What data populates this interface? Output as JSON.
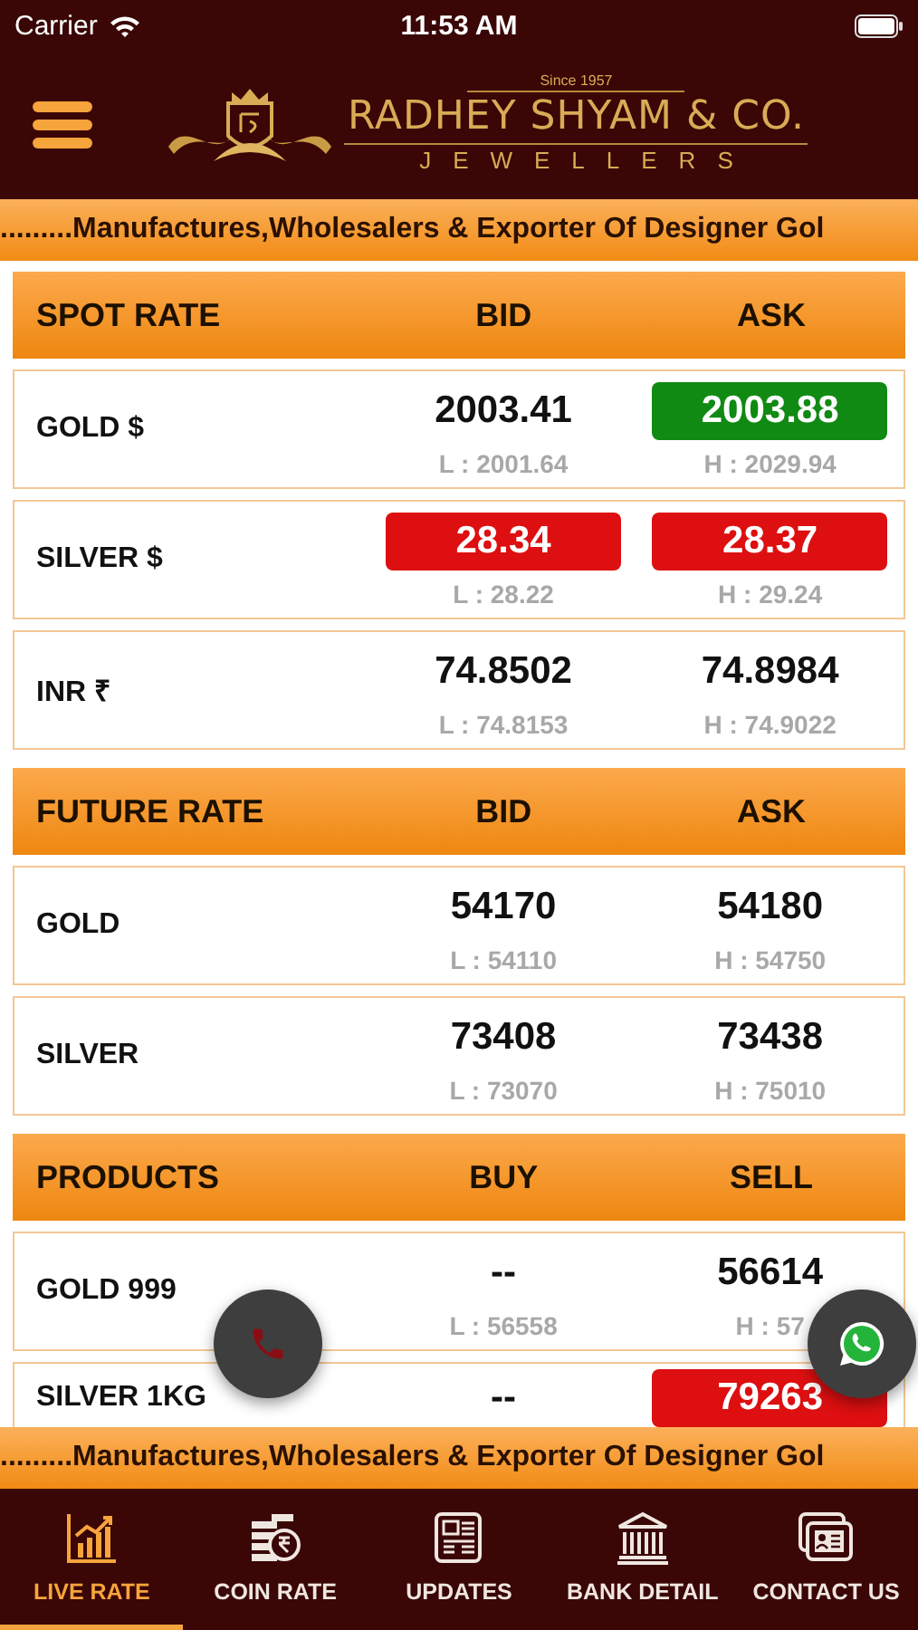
{
  "status_bar": {
    "carrier": "Carrier",
    "time": "11:53 AM"
  },
  "header": {
    "since": "Since 1957",
    "brand": "RADHEY SHYAM & CO.",
    "subtitle": "JEWELLERS"
  },
  "ticker_top": ".........Manufactures,Wholesalers & Exporter Of Designer Gol",
  "sections": [
    {
      "columns": [
        "SPOT RATE",
        "BID",
        "ASK"
      ],
      "rows": [
        {
          "name": "GOLD $",
          "bid": {
            "value": "2003.41",
            "kind": "plain"
          },
          "ask": {
            "value": "2003.88",
            "kind": "up"
          },
          "low": "L : 2001.64",
          "high": "H : 2029.94"
        },
        {
          "name": "SILVER $",
          "bid": {
            "value": "28.34",
            "kind": "down"
          },
          "ask": {
            "value": "28.37",
            "kind": "down"
          },
          "low": "L : 28.22",
          "high": "H : 29.24"
        },
        {
          "name": "INR ₹",
          "bid": {
            "value": "74.8502",
            "kind": "plain"
          },
          "ask": {
            "value": "74.8984",
            "kind": "plain"
          },
          "low": "L : 74.8153",
          "high": "H : 74.9022"
        }
      ]
    },
    {
      "columns": [
        "FUTURE RATE",
        "BID",
        "ASK"
      ],
      "rows": [
        {
          "name": "GOLD",
          "bid": {
            "value": "54170",
            "kind": "plain"
          },
          "ask": {
            "value": "54180",
            "kind": "plain"
          },
          "low": "L : 54110",
          "high": "H : 54750"
        },
        {
          "name": "SILVER",
          "bid": {
            "value": "73408",
            "kind": "plain"
          },
          "ask": {
            "value": "73438",
            "kind": "plain"
          },
          "low": "L : 73070",
          "high": "H : 75010"
        }
      ]
    },
    {
      "columns": [
        "PRODUCTS",
        "BUY",
        "SELL"
      ],
      "rows": [
        {
          "name": "GOLD 999",
          "bid": {
            "value": "--",
            "kind": "plain"
          },
          "ask": {
            "value": "56614",
            "kind": "plain"
          },
          "low": "L : 56558",
          "high": "H : 57"
        },
        {
          "name": "SILVER 1KG",
          "bid": {
            "value": "--",
            "kind": "plain"
          },
          "ask": {
            "value": "79263",
            "kind": "down"
          }
        }
      ]
    }
  ],
  "ticker_bottom": ".........Manufactures,Wholesalers & Exporter Of Designer Gol",
  "tabs": [
    {
      "label": "LIVE RATE",
      "selected": true
    },
    {
      "label": "COIN RATE",
      "selected": false
    },
    {
      "label": "UPDATES",
      "selected": false
    },
    {
      "label": "BANK DETAIL",
      "selected": false
    },
    {
      "label": "CONTACT US",
      "selected": false
    }
  ]
}
